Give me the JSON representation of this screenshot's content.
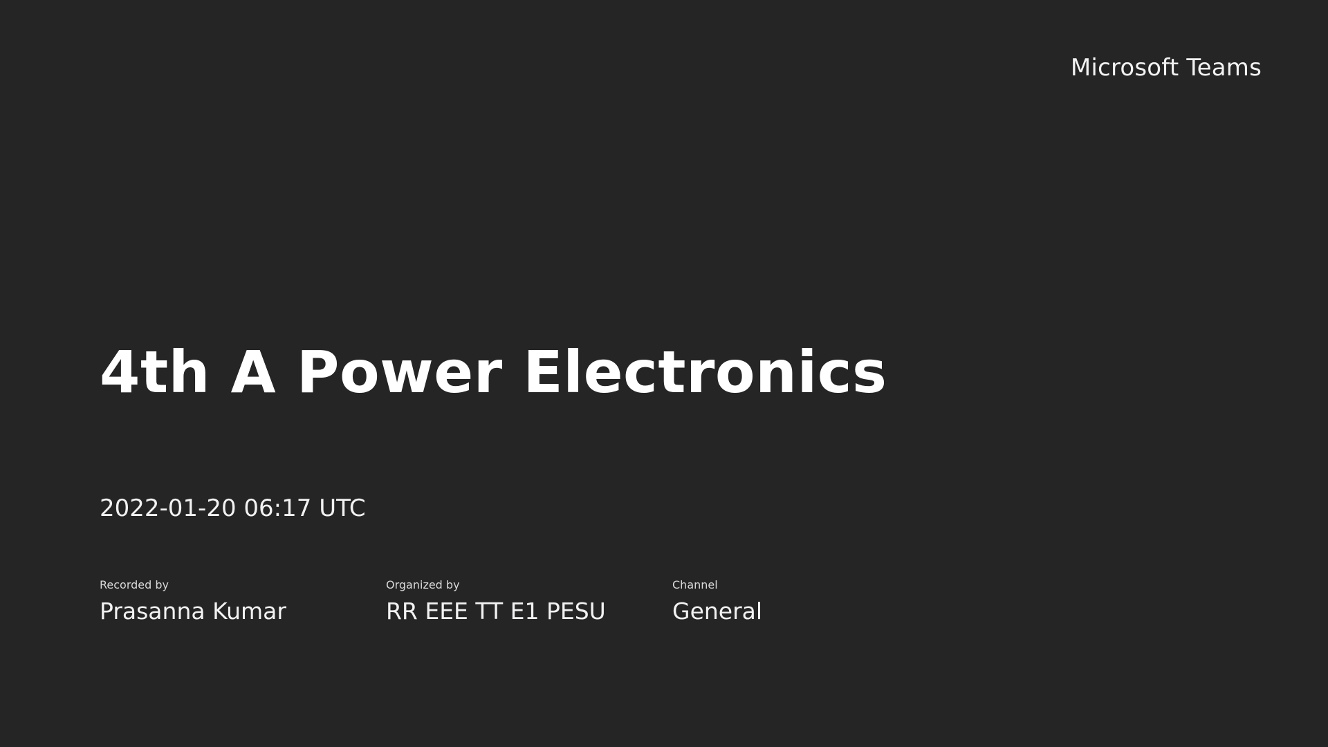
{
  "brand": {
    "app_name": "Microsoft Teams"
  },
  "recording": {
    "title": "4th A Power Electronics",
    "datetime": "2022-01-20 06:17 UTC"
  },
  "meta": [
    {
      "label": "Recorded by",
      "value": "Prasanna Kumar"
    },
    {
      "label": "Organized by",
      "value": "RR EEE TT E1 PESU"
    },
    {
      "label": "Channel",
      "value": "General"
    }
  ],
  "colors": {
    "background": "#252526",
    "text": "#ffffff"
  }
}
